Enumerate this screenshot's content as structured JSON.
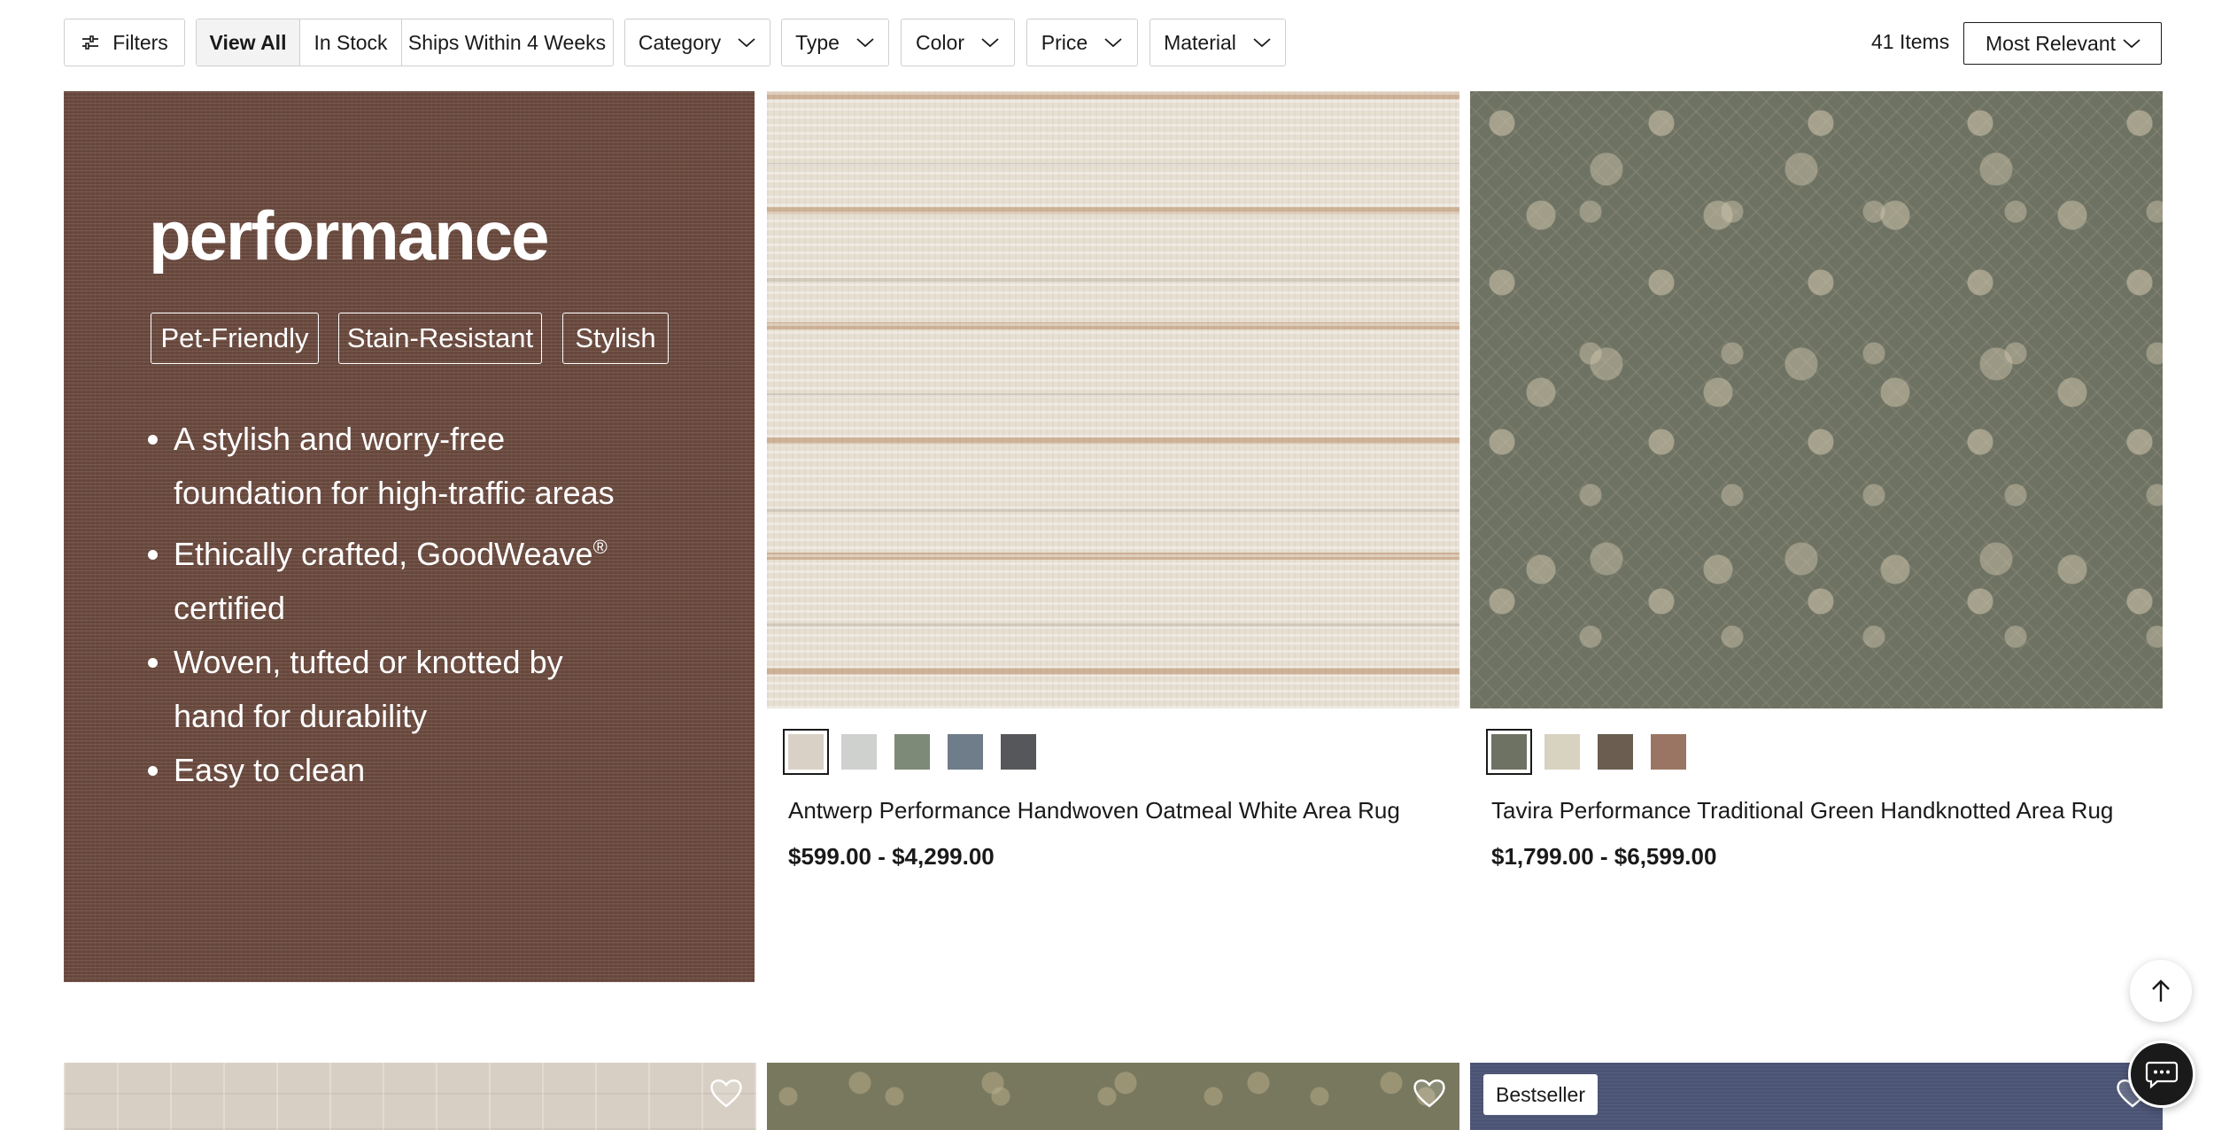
{
  "toolbar": {
    "filters_label": "Filters",
    "view_all_label": "View All",
    "in_stock_label": "In Stock",
    "ships_label": "Ships Within 4 Weeks",
    "category_label": "Category",
    "type_label": "Type",
    "color_label": "Color",
    "price_label": "Price",
    "material_label": "Material",
    "item_count": "41 Items",
    "sort_label": "Most Relevant"
  },
  "promo": {
    "title": "performance",
    "chips": [
      "Pet-Friendly",
      "Stain-Resistant",
      "Stylish"
    ],
    "bullets": {
      "b1": "A stylish and worry-free foundation for high-traffic areas",
      "b2_text": "Ethically crafted, GoodWeave",
      "b2_sup": "®",
      "b2_tail": " certified",
      "b3": "Woven, tufted or knotted by hand for durability",
      "b4": "Easy to clean"
    },
    "background_color": "#6b4a3f"
  },
  "products": [
    {
      "name": "Antwerp Performance Handwoven Oatmeal White Area Rug",
      "price": "$599.00 - $4,299.00",
      "swatches": [
        "#d9d1c6",
        "#cfd1cf",
        "#7d8a77",
        "#6f7c89",
        "#55575a"
      ],
      "selected_swatch": 0
    },
    {
      "name": "Tavira Performance Traditional Green Handknotted Area Rug",
      "price": "$1,799.00 - $6,599.00",
      "swatches": [
        "#6e7263",
        "#d8d2c0",
        "#6b5d4f",
        "#9a7563"
      ],
      "selected_swatch": 0
    }
  ],
  "bottom_row": {
    "badge_label": "Bestseller"
  },
  "icons": {
    "filters": "sliders-icon",
    "chevron": "chevron-down-icon",
    "heart": "heart-icon",
    "back_to_top": "arrow-up-icon",
    "chat": "chat-icon"
  }
}
